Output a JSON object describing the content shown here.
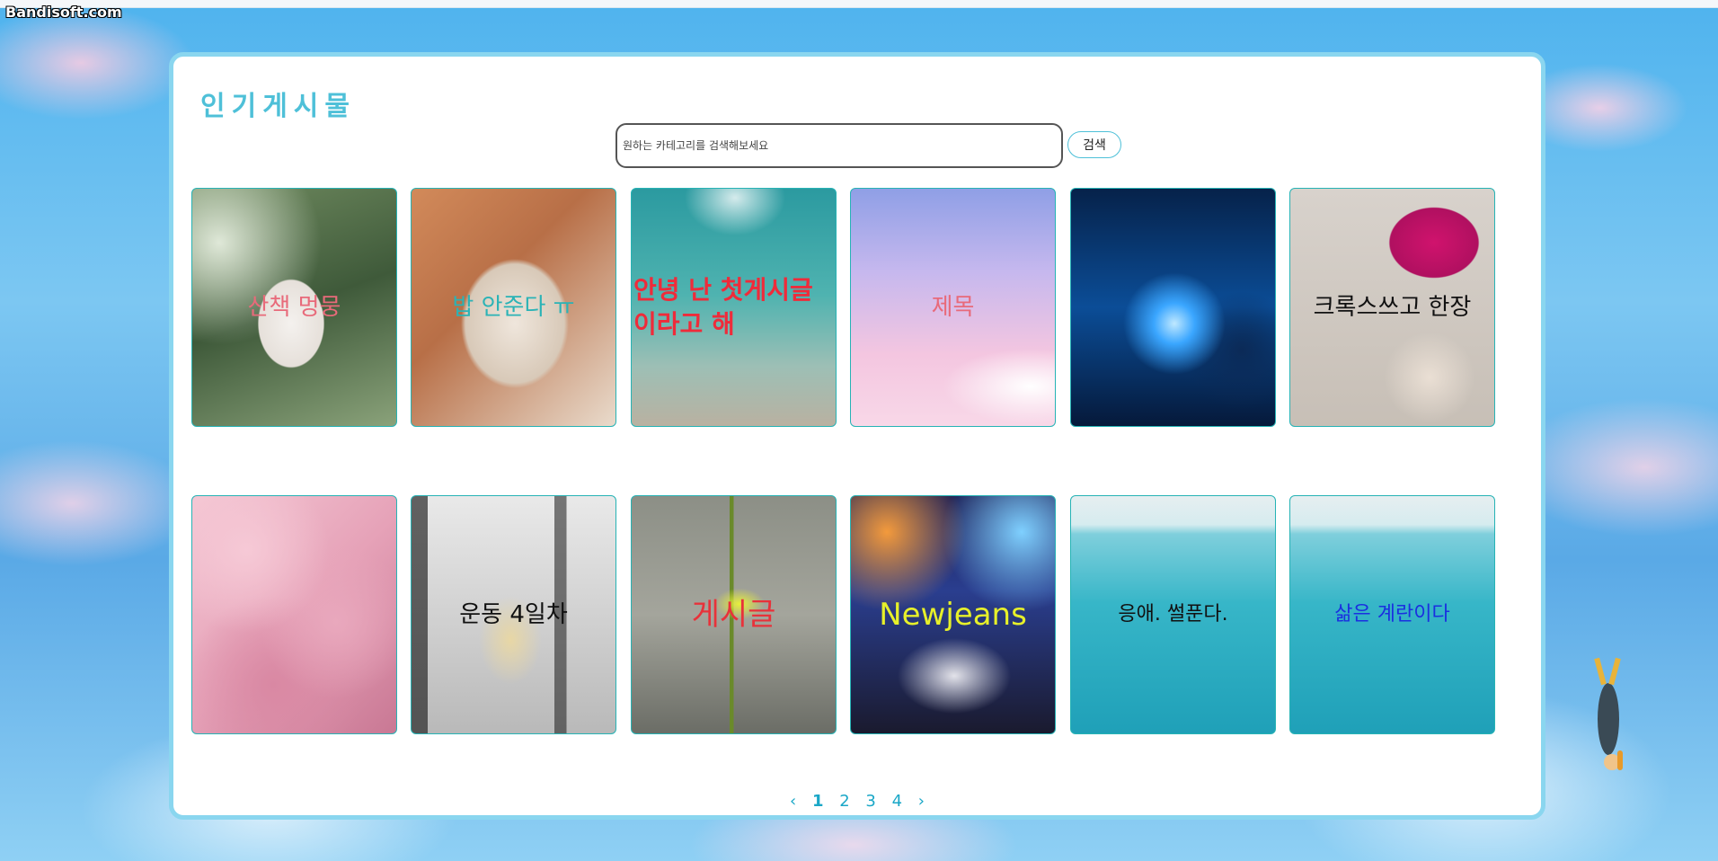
{
  "watermark": "Bandisoft.com",
  "page": {
    "title": "인기게시물"
  },
  "search": {
    "placeholder": "원하는 카테고리를 검색해보세요",
    "button_label": "검색"
  },
  "posts": [
    {
      "title": "산책 멍뭉",
      "title_color": "#e86a7a",
      "image": "white-dog-smiling"
    },
    {
      "title": "밥 안준다 ㅠ",
      "title_color": "#2bb3b6",
      "image": "chihuahua-closeup"
    },
    {
      "title": "안녕 난 첫게시글이라고 해",
      "title_color": "#ef2b3a",
      "image": "underwater-sunlight"
    },
    {
      "title": "제목",
      "title_color": "#e86a7a",
      "image": "rainbow-sky"
    },
    {
      "title": "",
      "title_color": "#ffffff",
      "image": "space-planets"
    },
    {
      "title": "크록스쓰고 한장",
      "title_color": "#111111",
      "image": "dog-crocs-hat"
    },
    {
      "title": "",
      "title_color": "#e86a7a",
      "image": "cherry-blossom"
    },
    {
      "title": "운동 4일차",
      "title_color": "#111111",
      "image": "gym-workout"
    },
    {
      "title": "게시글",
      "title_color": "#e8323a",
      "image": "flower-rain"
    },
    {
      "title": "Newjeans",
      "title_color": "#e7f02a",
      "image": "newjeans-group"
    },
    {
      "title": "응애. 썰푼다.",
      "title_color": "#111111",
      "image": "ocean"
    },
    {
      "title": "삶은 계란이다",
      "title_color": "#1a2fe0",
      "image": "ocean"
    }
  ],
  "pagination": {
    "prev": "‹",
    "pages": [
      "1",
      "2",
      "3",
      "4"
    ],
    "current": "1",
    "next": "›"
  }
}
